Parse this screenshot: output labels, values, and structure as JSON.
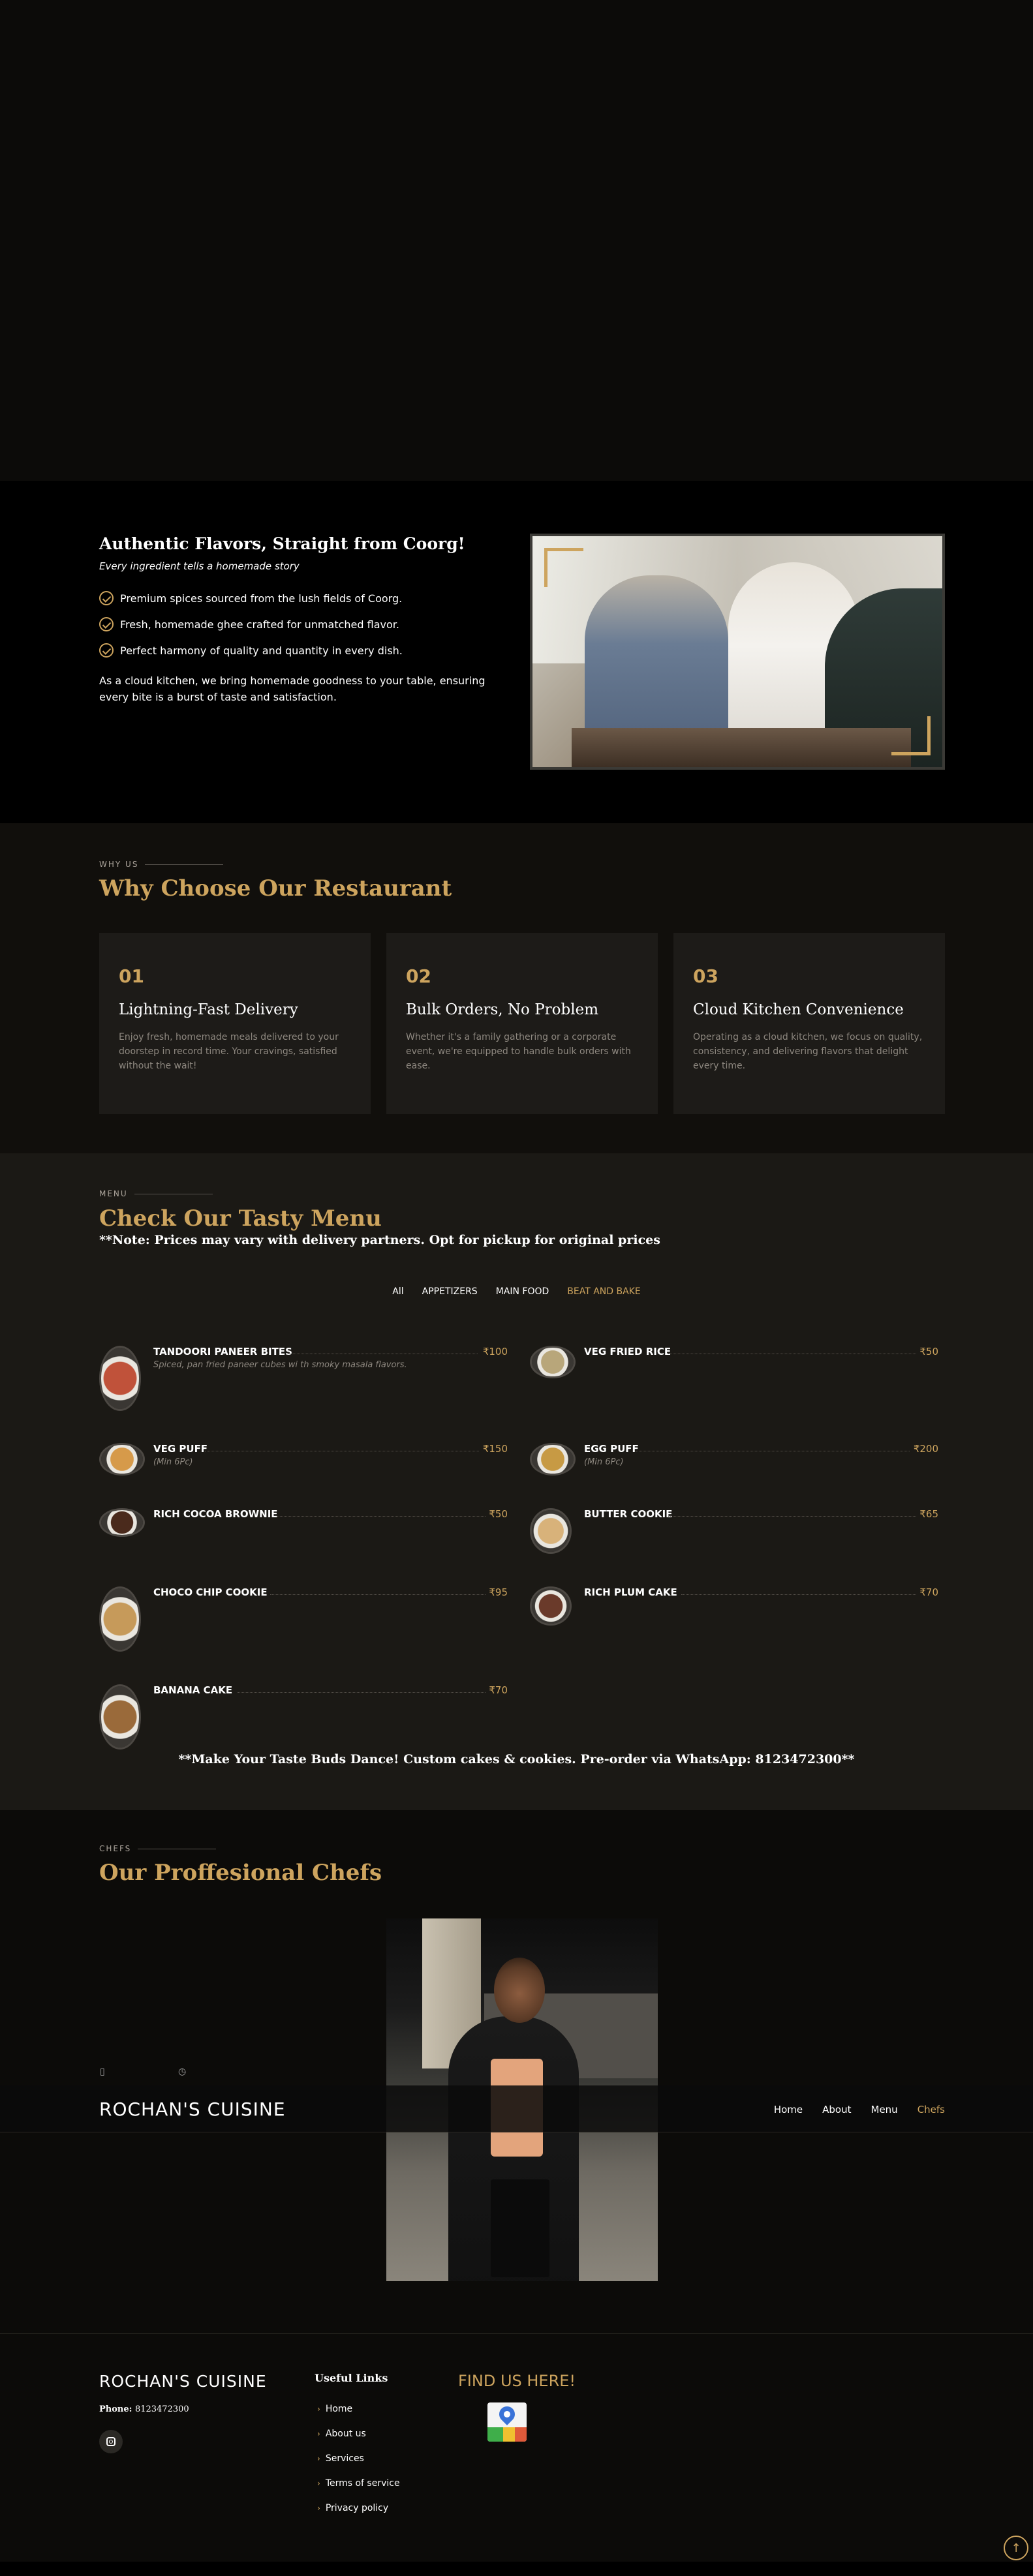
{
  "about": {
    "title": "Authentic Flavors, Straight from Coorg!",
    "subtitle": "Every ingredient tells a homemade story",
    "points": [
      "Premium spices sourced from the lush fields of Coorg.",
      "Fresh, homemade ghee crafted for unmatched flavor.",
      "Perfect harmony of quality and quantity in every dish."
    ],
    "paragraph": "As a cloud kitchen, we bring homemade goodness to your table, ensuring every bite is a burst of taste and satisfaction."
  },
  "why": {
    "tag": "WHY US",
    "title": "Why Choose Our Restaurant",
    "cards": [
      {
        "num": "01",
        "title": "Lightning-Fast Delivery",
        "text": "Enjoy fresh, homemade meals delivered to your doorstep in record time. Your cravings, satisfied without the wait!"
      },
      {
        "num": "02",
        "title": "Bulk Orders, No Problem",
        "text": "Whether it's a family gathering or a corporate event, we're equipped to handle bulk orders with ease."
      },
      {
        "num": "03",
        "title": "Cloud Kitchen Convenience",
        "text": "Operating as a cloud kitchen, we focus on quality, consistency, and delivering flavors that delight every time."
      }
    ]
  },
  "menu": {
    "tag": "MENU",
    "title": "Check Our Tasty Menu",
    "note": "**Note: Prices may vary with delivery partners. Opt for pickup for original prices",
    "filters": [
      "All",
      "APPETIZERS",
      "MAIN FOOD",
      "BEAT AND BAKE"
    ],
    "items": [
      {
        "name": "TANDOORI PANEER BITES",
        "price": "₹100",
        "desc": "Spiced, pan fried paneer cubes wi th smoky masala flavors.",
        "color": "#c0523a"
      },
      {
        "name": "VEG FRIED RICE",
        "price": "₹50",
        "desc": "",
        "color": "#b8a67a"
      },
      {
        "name": "VEG PUFF",
        "price": "₹150",
        "desc": "(Min 6Pc)",
        "color": "#d69a4a"
      },
      {
        "name": "EGG PUFF",
        "price": "₹200",
        "desc": "(Min 6Pc)",
        "color": "#c79a44"
      },
      {
        "name": "RICH COCOA BROWNIE",
        "price": "₹50",
        "desc": "",
        "color": "#4a2a1c"
      },
      {
        "name": "BUTTER COOKIE",
        "price": "₹65",
        "desc": "",
        "color": "#d8b27a"
      },
      {
        "name": "CHOCO CHIP COOKIE",
        "price": "₹95",
        "desc": "",
        "color": "#c69a5a"
      },
      {
        "name": "RICH PLUM CAKE",
        "price": "₹70",
        "desc": "",
        "color": "#6a3a2a"
      },
      {
        "name": "BANANA CAKE",
        "price": "₹70",
        "desc": "",
        "color": "#9a6a3a"
      }
    ],
    "footer_note": "**Make Your Taste Buds Dance! Custom cakes & cookies. Pre-order via WhatsApp: 8123472300**"
  },
  "chefs": {
    "tag": "CHEFS",
    "title": "Our Proffesional Chefs"
  },
  "header": {
    "logo": "ROCHAN'S CUISINE",
    "nav": [
      "Home",
      "About",
      "Menu",
      "Chefs"
    ],
    "active": "Chefs",
    "topbar_icons": [
      "phone-icon",
      "clock-icon"
    ],
    "topbar_glyphs": [
      "▯",
      "◷"
    ]
  },
  "footer": {
    "logo": "ROCHAN'S CUISINE",
    "phone_label": "Phone:",
    "phone": "8123472300",
    "links_title": "Useful Links",
    "links": [
      "Home",
      "About us",
      "Services",
      "Terms of service",
      "Privacy policy"
    ],
    "find_us": "FIND US HERE!",
    "social_icon": "instagram-icon",
    "to_top": "↑"
  },
  "colors": {
    "accent": "#cda45e",
    "background": "#0c0b09",
    "card": "#1d1b18",
    "menu_bg": "#1b1915"
  }
}
